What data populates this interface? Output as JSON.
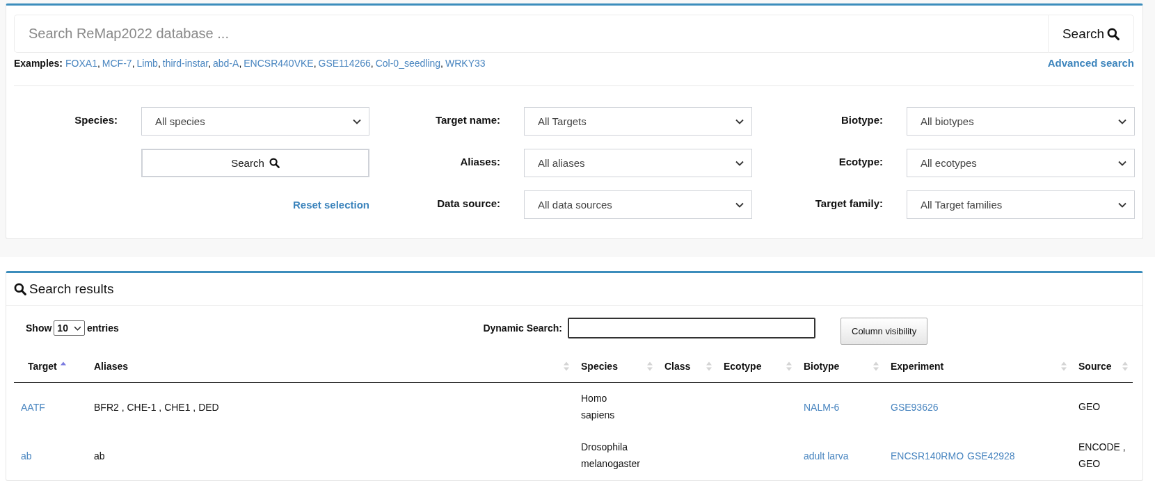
{
  "search": {
    "placeholder": "Search ReMap2022 database ...",
    "button": "Search"
  },
  "examples": {
    "label": "Examples:",
    "links": [
      {
        "text": "FOXA1",
        "after": ","
      },
      {
        "text": "MCF-7",
        "after": ","
      },
      {
        "text": "Limb",
        "after": ","
      },
      {
        "text": "third-instar",
        "after": ","
      },
      {
        "text": "abd-A",
        "after": ","
      },
      {
        "text": "ENCSR440VKE",
        "after": ","
      },
      {
        "text": "GSE114266",
        "after": ","
      },
      {
        "text": "Col-0_seedling",
        "after": ","
      },
      {
        "text": "WRKY33"
      }
    ]
  },
  "advanced_search": "Advanced search",
  "filter_rows": [
    [
      {
        "kind": "select",
        "label": "Species:",
        "value": "All species"
      },
      {
        "kind": "select",
        "label": "Target name:",
        "value": "All Targets"
      },
      {
        "kind": "select",
        "label": "Biotype:",
        "value": "All biotypes"
      }
    ],
    [
      {
        "kind": "button",
        "label": "Search"
      },
      {
        "kind": "select",
        "label": "Aliases:",
        "value": "All aliases"
      },
      {
        "kind": "select",
        "label": "Ecotype:",
        "value": "All ecotypes"
      }
    ],
    [
      {
        "kind": "link",
        "label": "Reset selection"
      },
      {
        "kind": "select",
        "label": "Data source:",
        "value": "All data sources"
      },
      {
        "kind": "select",
        "label": "Target family:",
        "value": "All Target families"
      }
    ]
  ],
  "results": {
    "title": "Search results",
    "show_label": "Show",
    "page_size": "10",
    "entries_label": "entries",
    "dynamic_search_label": "Dynamic Search:",
    "column_visibility": "Column visibility",
    "columns": [
      {
        "label": "Target",
        "sorted_ascending": true
      },
      {
        "label": "Aliases",
        "sorted_ascending": false
      },
      {
        "label": "Species",
        "sorted_ascending": false
      },
      {
        "label": "Class",
        "sorted_ascending": false
      },
      {
        "label": "Ecotype",
        "sorted_ascending": false
      },
      {
        "label": "Biotype",
        "sorted_ascending": false
      },
      {
        "label": "Experiment",
        "sorted_ascending": false
      },
      {
        "label": "Source",
        "sorted_ascending": false
      }
    ],
    "rows": [
      {
        "target": "AATF",
        "aliases": "BFR2 , CHE-1 , CHE1 , DED",
        "species": "Homo sapiens",
        "biotype": "NALM-6",
        "experiments": [
          "GSE93626"
        ],
        "source": "GEO"
      },
      {
        "target": "ab",
        "aliases": "ab",
        "species": "Drosophila melanogaster",
        "biotype": "adult larva",
        "experiments": [
          "ENCSR140RMO",
          "GSE42928"
        ],
        "source": "ENCODE , GEO"
      }
    ]
  }
}
